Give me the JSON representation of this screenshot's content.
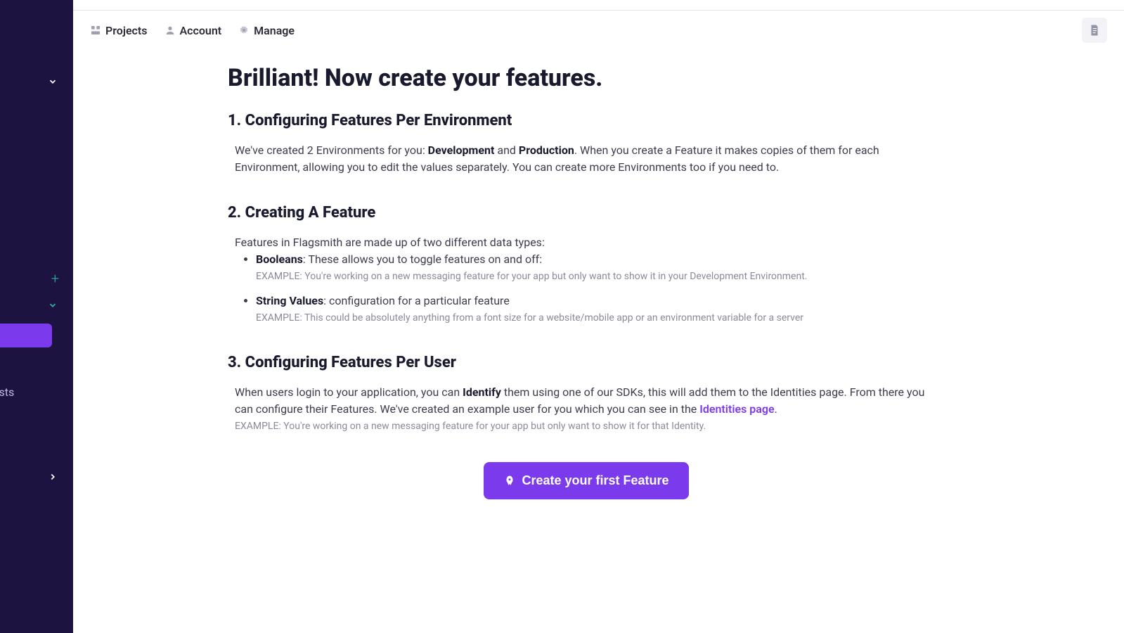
{
  "sidebar": {
    "partial_label": "ests"
  },
  "topbar": {
    "nav": [
      {
        "label": "Projects",
        "icon": "grid"
      },
      {
        "label": "Account",
        "icon": "user"
      },
      {
        "label": "Manage",
        "icon": "gear"
      }
    ]
  },
  "page": {
    "title": "Brilliant! Now create your features.",
    "sections": {
      "s1": {
        "heading": "1. Configuring Features Per Environment",
        "intro_pre": "We've created 2 Environments for you: ",
        "env1": "Development",
        "intro_mid": " and ",
        "env2": "Production",
        "intro_post": ". When you create a Feature it makes copies of them for each Environment, allowing you to edit the values separately. You can create more Environments too if you need to."
      },
      "s2": {
        "heading": "2. Creating A Feature",
        "intro": "Features in Flagsmith are made up of two different data types:",
        "items": [
          {
            "name": "Booleans",
            "desc": ": These allows you to toggle features on and off:",
            "example": "EXAMPLE: You're working on a new messaging feature for your app but only want to show it in your Development Environment."
          },
          {
            "name": "String Values",
            "desc": ": configuration for a particular feature",
            "example": "EXAMPLE: This could be absolutely anything from a font size for a website/mobile app or an environment variable for a server"
          }
        ]
      },
      "s3": {
        "heading": "3. Configuring Features Per User",
        "body_pre": "When users login to your application, you can ",
        "identify": "Identify",
        "body_mid": " them using one of our SDKs, this will add them to the Identities page. From there you can configure their Features. We've created an example user for you which you can see in the ",
        "link_text": "Identities page",
        "body_post": ".",
        "example": "EXAMPLE: You're working on a new messaging feature for your app but only want to show it for that Identity."
      }
    },
    "cta_label": "Create your first Feature"
  }
}
